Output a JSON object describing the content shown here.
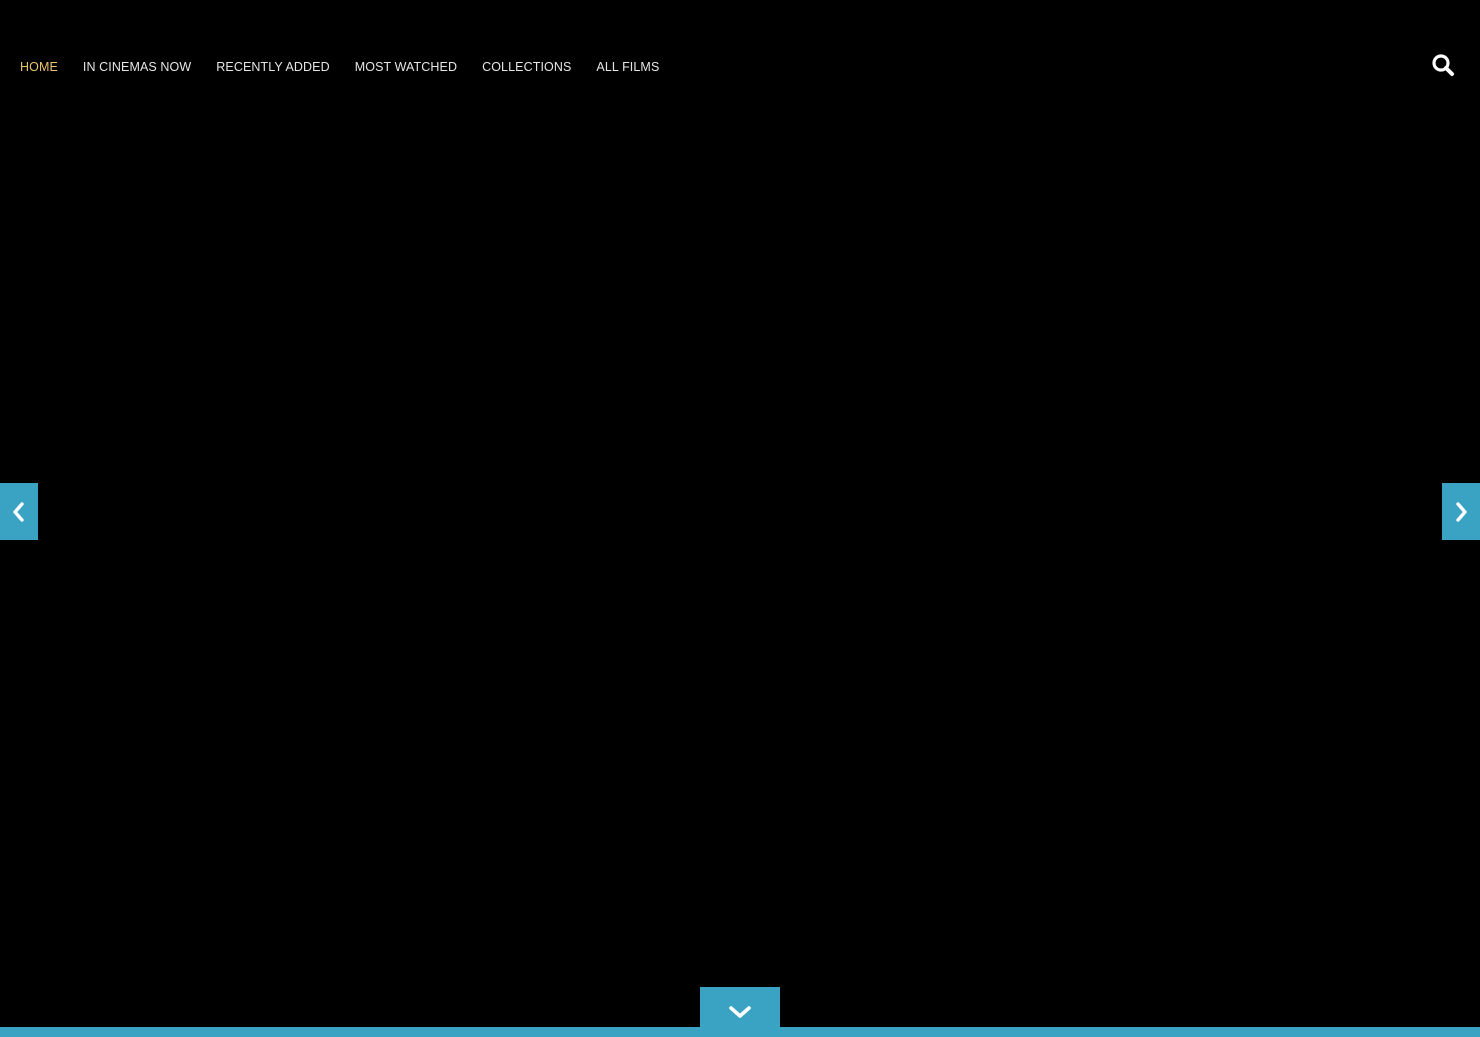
{
  "nav": {
    "items": [
      {
        "label": "HOME",
        "active": true
      },
      {
        "label": "IN CINEMAS NOW",
        "active": false
      },
      {
        "label": "RECENTLY ADDED",
        "active": false
      },
      {
        "label": "MOST WATCHED",
        "active": false
      },
      {
        "label": "COLLECTIONS",
        "active": false
      },
      {
        "label": "ALL FILMS",
        "active": false
      }
    ],
    "search_icon": "search-icon"
  },
  "slider": {
    "prev_icon": "chevron-left-icon",
    "next_icon": "chevron-right-icon"
  },
  "scroll_down_icon": "chevron-down-icon",
  "colors": {
    "background": "#000000",
    "accent": "#3aa3c4",
    "nav_text": "#e6e6e6",
    "nav_active": "#e7c36b",
    "icon": "#ffffff"
  }
}
